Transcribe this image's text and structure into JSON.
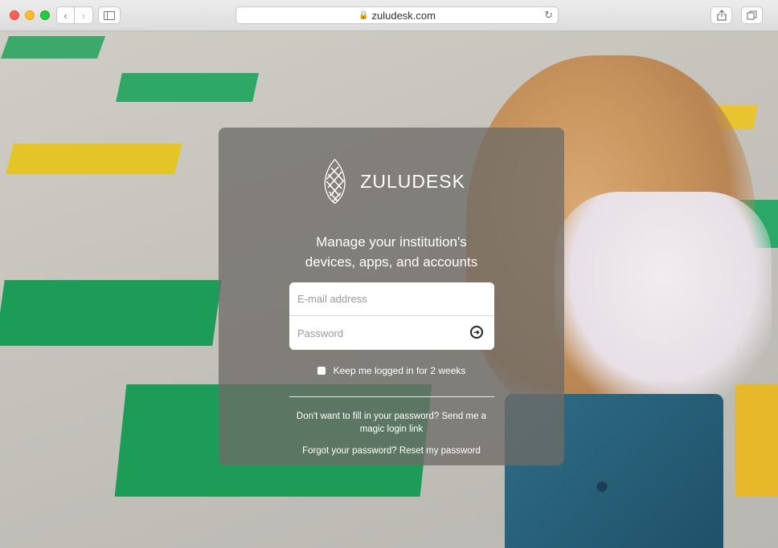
{
  "browser": {
    "url": "zuludesk.com",
    "icons": {
      "back": "chevron-left-icon",
      "forward": "chevron-right-icon",
      "sidebar": "sidebar-icon",
      "lock": "lock-icon",
      "reload": "reload-icon",
      "share": "share-icon",
      "tabs": "tabs-icon"
    }
  },
  "login": {
    "brand": "ZULUDESK",
    "tagline_line1": "Manage your institution's",
    "tagline_line2": "devices, apps, and accounts",
    "email_placeholder": "E-mail address",
    "password_placeholder": "Password",
    "remember_label": "Keep me logged in for 2 weeks",
    "magic_link_text": "Don't want to fill in your password? Send me a magic login link",
    "forgot_text": "Forgot your password? Reset my password"
  },
  "colors": {
    "card_overlay": "#6e6c68",
    "accent_white": "#ffffff"
  }
}
